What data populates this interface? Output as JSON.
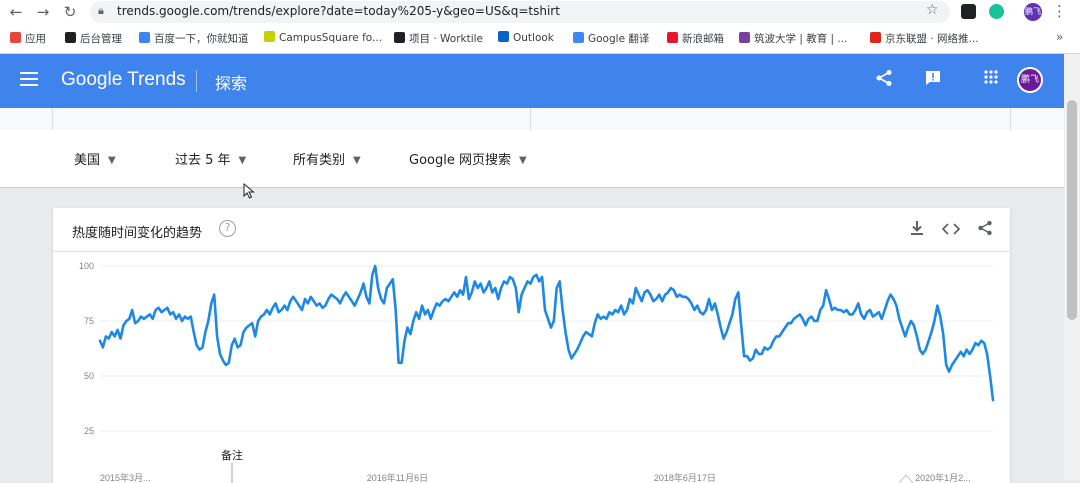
{
  "browser": {
    "url": "trends.google.com/trends/explore?date=today%205-y&geo=US&q=tshirt",
    "bookmarks": [
      {
        "label": "应用",
        "color": "#e8453c"
      },
      {
        "label": "后台管理",
        "color": "#202124"
      },
      {
        "label": "百度一下，你就知道",
        "color": "#3f83ec"
      },
      {
        "label": "CampusSquare fo...",
        "color": "#c6d000"
      },
      {
        "label": "项目 · Worktile",
        "color": "#202124"
      },
      {
        "label": "Outlook",
        "color": "#0a64c8"
      },
      {
        "label": "Google 翻译",
        "color": "#4285f4"
      },
      {
        "label": "新浪邮箱",
        "color": "#e6162d"
      },
      {
        "label": "筑波大学 | 教育 | ...",
        "color": "#7b3fa0"
      },
      {
        "label": "京东联盟 · 网络推...",
        "color": "#e1251b"
      }
    ],
    "profile_initials": "鹏飞"
  },
  "appbar": {
    "logo": "Google Trends",
    "title": "探索",
    "avatar_initials": "鹏飞",
    "color": "#3f83ec"
  },
  "filters": {
    "region": "美国",
    "time": "过去 5 年",
    "category": "所有类别",
    "search_type": "Google 网页搜索"
  },
  "card": {
    "title": "热度随时间变化的趋势",
    "help_icon": "?"
  },
  "chart_data": {
    "type": "line",
    "ylim": [
      0,
      100
    ],
    "yticks": [
      "100",
      "75",
      "50",
      "25"
    ],
    "xticks": [
      "2015年3月...",
      "2016年11月6日",
      "2018年6月17日",
      "2020年1月2..."
    ],
    "note_label": "备注",
    "series": [
      {
        "color": "#1e88e5",
        "values": [
          66,
          63,
          68,
          67,
          70,
          68,
          71,
          67,
          73,
          75,
          76,
          80,
          74,
          75,
          77,
          76,
          77,
          78,
          76,
          80,
          81,
          79,
          80,
          81,
          78,
          79,
          76,
          78,
          75,
          77,
          76,
          77,
          70,
          64,
          62,
          63,
          70,
          75,
          83,
          87,
          68,
          60,
          57,
          55,
          56,
          64,
          67,
          63,
          64,
          70,
          72,
          73,
          74,
          68,
          75,
          77,
          78,
          80,
          78,
          81,
          83,
          79,
          80,
          82,
          80,
          84,
          86,
          84,
          82,
          80,
          85,
          83,
          86,
          84,
          82,
          83,
          81,
          82,
          85,
          87,
          86,
          85,
          83,
          86,
          88,
          86,
          84,
          82,
          85,
          88,
          92,
          86,
          83,
          96,
          100,
          90,
          85,
          83,
          90,
          92,
          94,
          80,
          56,
          56,
          66,
          72,
          69,
          75,
          79,
          76,
          82,
          78,
          80,
          76,
          80,
          83,
          82,
          84,
          85,
          84,
          86,
          88,
          86,
          89,
          87,
          95,
          85,
          88,
          93,
          90,
          92,
          88,
          90,
          93,
          88,
          90,
          85,
          90,
          93,
          92,
          95,
          94,
          90,
          79,
          87,
          90,
          93,
          92,
          95,
          96,
          93,
          95,
          80,
          76,
          72,
          75,
          90,
          93,
          80,
          70,
          62,
          58,
          60,
          62,
          65,
          68,
          70,
          69,
          68,
          74,
          78,
          76,
          77,
          76,
          79,
          78,
          80,
          79,
          82,
          78,
          80,
          85,
          83,
          90,
          87,
          84,
          88,
          89,
          87,
          84,
          85,
          87,
          84,
          87,
          88,
          90,
          89,
          86,
          87,
          86,
          86,
          85,
          83,
          80,
          82,
          79,
          78,
          80,
          85,
          80,
          83,
          78,
          72,
          67,
          70,
          74,
          78,
          85,
          88,
          73,
          59,
          59,
          57,
          58,
          62,
          60,
          60,
          63,
          62,
          63,
          66,
          68,
          68,
          70,
          72,
          74,
          74,
          76,
          77,
          78,
          76,
          73,
          76,
          77,
          75,
          75,
          80,
          82,
          89,
          85,
          80,
          81,
          80,
          80,
          79,
          80,
          78,
          78,
          80,
          83,
          78,
          76,
          79,
          80,
          77,
          78,
          79,
          76,
          80,
          84,
          87,
          85,
          82,
          76,
          72,
          68,
          72,
          75,
          73,
          68,
          62,
          60,
          62,
          66,
          70,
          75,
          82,
          77,
          69,
          55,
          52,
          55,
          57,
          59,
          61,
          59,
          62,
          60,
          62,
          65,
          64,
          66,
          65,
          60,
          50,
          39
        ]
      }
    ]
  }
}
